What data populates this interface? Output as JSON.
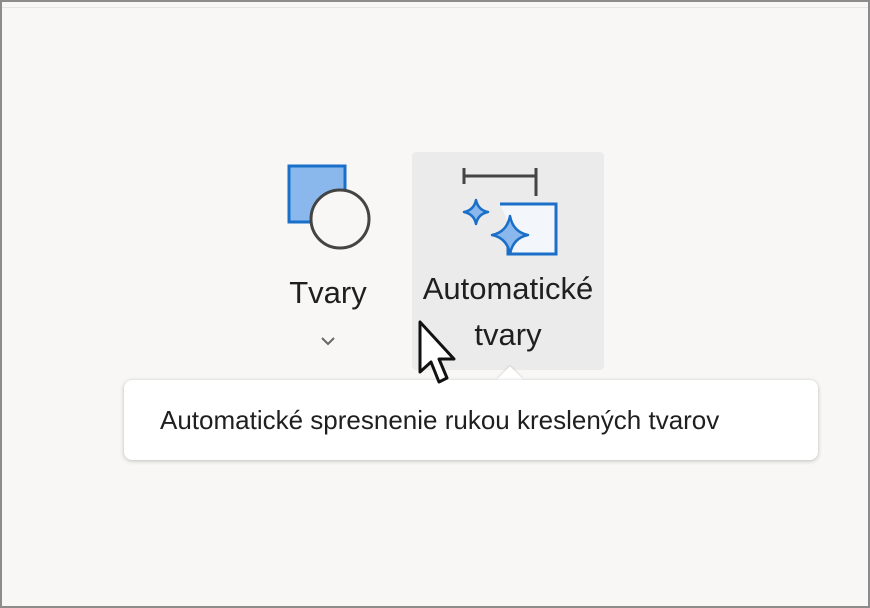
{
  "ribbon": {
    "shapes": {
      "label": "Tvary",
      "icon": "shapes-icon",
      "has_dropdown": true
    },
    "auto_shapes": {
      "label_line1": "Automatické",
      "label_line2": "tvary",
      "icon": "auto-shapes-icon",
      "hovered": true
    }
  },
  "tooltip": {
    "text": "Automatické spresnenie rukou kreslených tvarov"
  },
  "colors": {
    "background": "#f8f7f6",
    "hover": "#ebebeb",
    "accent_blue": "#1a6fc9",
    "accent_blue_light": "#8ab8ec"
  }
}
